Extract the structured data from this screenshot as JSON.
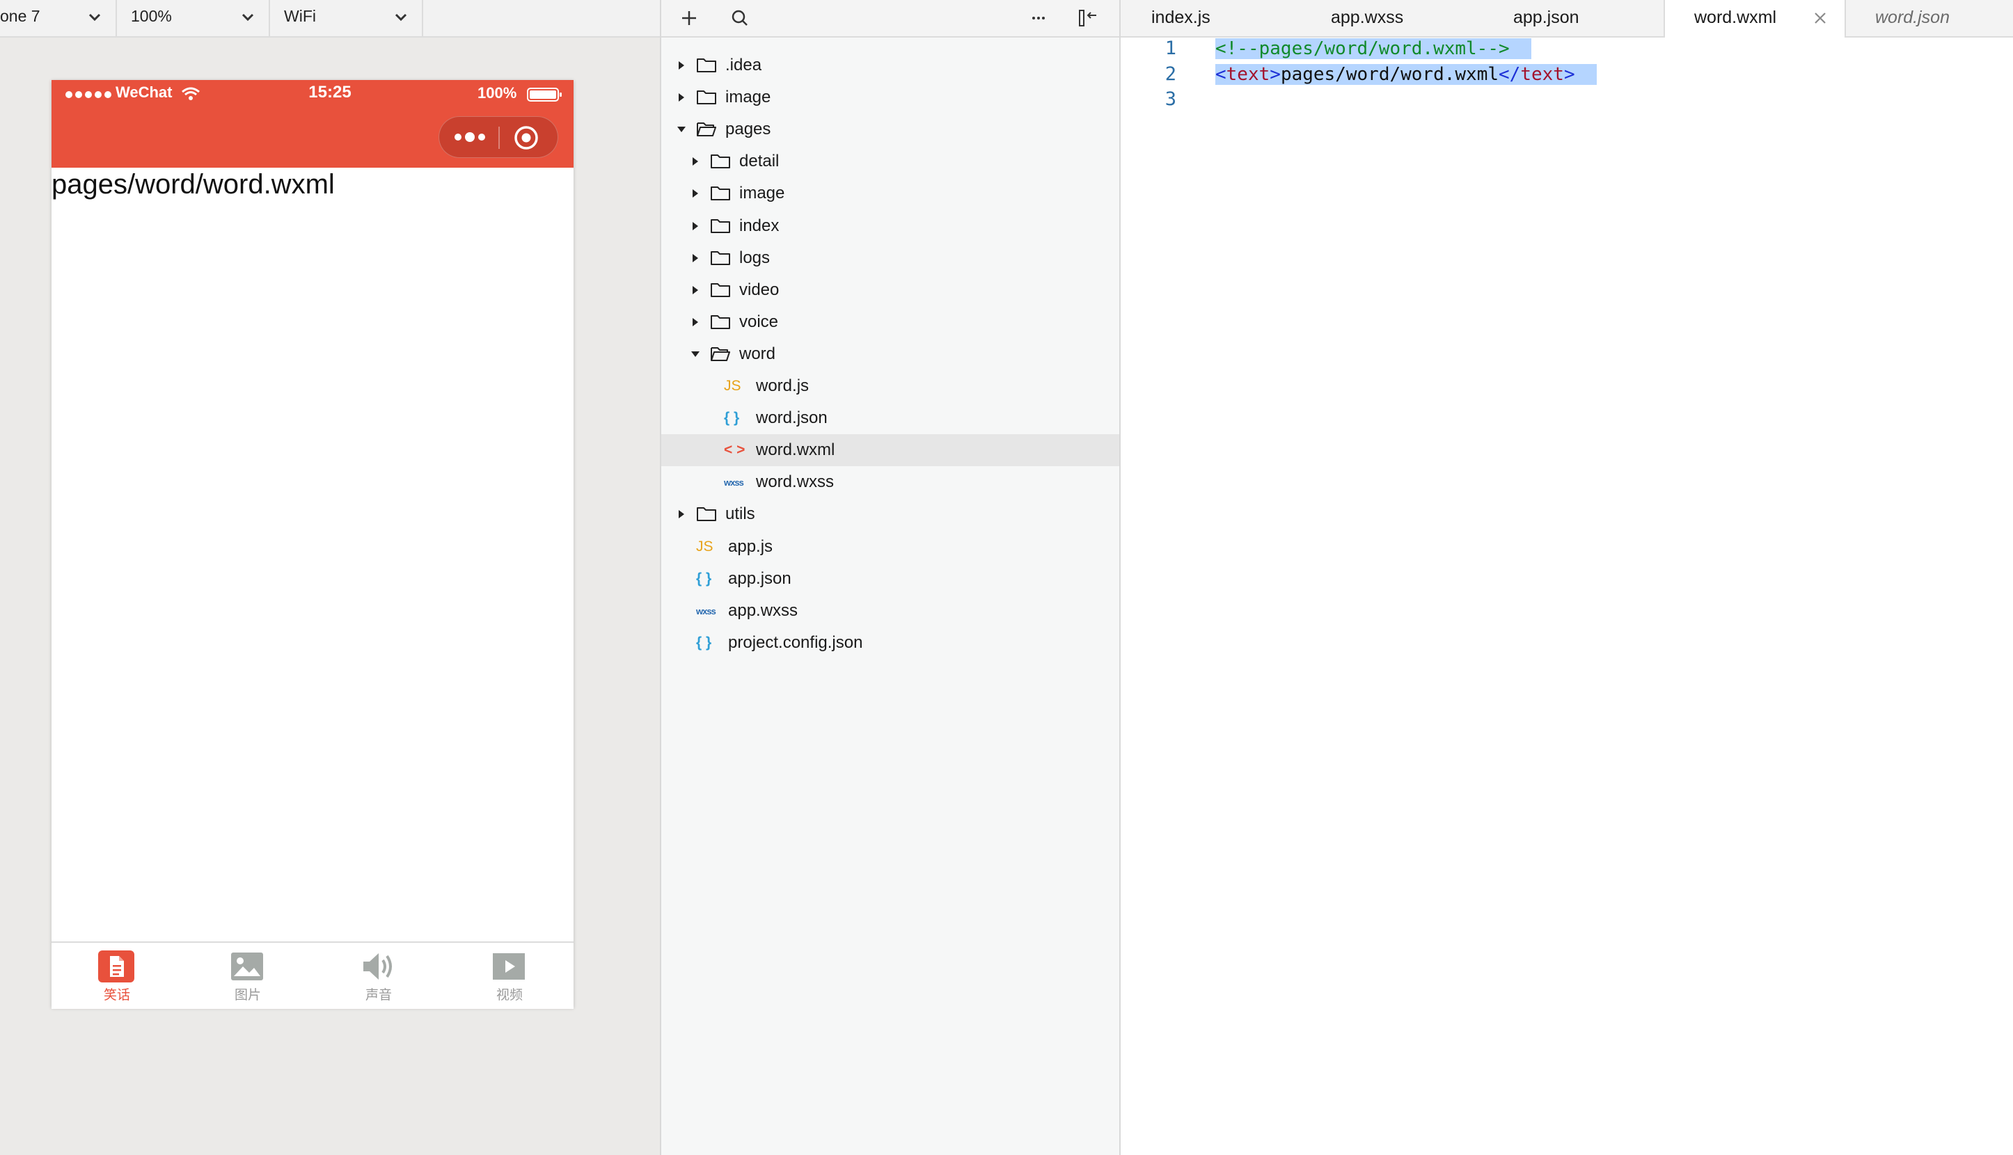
{
  "simulator": {
    "toolbar": {
      "device": "one 7",
      "zoom": "100%",
      "network": "WiFi"
    },
    "status_bar": {
      "carrier": "WeChat",
      "time": "15:25",
      "battery": "100%"
    },
    "page_text": "pages/word/word.wxml",
    "tabbar": [
      {
        "label": "笑话",
        "icon": "document-icon",
        "active": true
      },
      {
        "label": "图片",
        "icon": "image-icon",
        "active": false
      },
      {
        "label": "声音",
        "icon": "speaker-icon",
        "active": false
      },
      {
        "label": "视频",
        "icon": "video-icon",
        "active": false
      }
    ],
    "accent_color": "#e8513c"
  },
  "explorer": {
    "tree": [
      {
        "label": ".idea",
        "type": "folder",
        "depth": 0,
        "expanded": false
      },
      {
        "label": "image",
        "type": "folder",
        "depth": 0,
        "expanded": false
      },
      {
        "label": "pages",
        "type": "folder",
        "depth": 0,
        "expanded": true
      },
      {
        "label": "detail",
        "type": "folder",
        "depth": 1,
        "expanded": false
      },
      {
        "label": "image",
        "type": "folder",
        "depth": 1,
        "expanded": false
      },
      {
        "label": "index",
        "type": "folder",
        "depth": 1,
        "expanded": false
      },
      {
        "label": "logs",
        "type": "folder",
        "depth": 1,
        "expanded": false
      },
      {
        "label": "video",
        "type": "folder",
        "depth": 1,
        "expanded": false
      },
      {
        "label": "voice",
        "type": "folder",
        "depth": 1,
        "expanded": false
      },
      {
        "label": "word",
        "type": "folder",
        "depth": 1,
        "expanded": true
      },
      {
        "label": "word.js",
        "type": "js",
        "badge": "JS",
        "depth": 2
      },
      {
        "label": "word.json",
        "type": "json",
        "badge": "{ }",
        "depth": 2
      },
      {
        "label": "word.wxml",
        "type": "wxml",
        "badge": "< >",
        "depth": 2,
        "selected": true
      },
      {
        "label": "word.wxss",
        "type": "wxss",
        "badge": "wxss",
        "depth": 2
      },
      {
        "label": "utils",
        "type": "folder",
        "depth": 0,
        "expanded": false
      },
      {
        "label": "app.js",
        "type": "js",
        "badge": "JS",
        "depth": 0
      },
      {
        "label": "app.json",
        "type": "json",
        "badge": "{ }",
        "depth": 0
      },
      {
        "label": "app.wxss",
        "type": "wxss",
        "badge": "wxss",
        "depth": 0
      },
      {
        "label": "project.config.json",
        "type": "json",
        "badge": "{ }",
        "depth": 0
      }
    ]
  },
  "editor": {
    "tabs": [
      {
        "label": "index.js"
      },
      {
        "label": "app.wxss"
      },
      {
        "label": "app.json"
      },
      {
        "label": "word.wxml",
        "active": true
      },
      {
        "label": "word.json",
        "preview": true
      }
    ],
    "lines": [
      {
        "num": "1",
        "tokens": [
          [
            "c-comment",
            "<!--pages/word/word.wxml-->"
          ]
        ]
      },
      {
        "num": "2",
        "tokens": [
          [
            "c-punct",
            "<"
          ],
          [
            "c-tag",
            "text"
          ],
          [
            "c-punct",
            ">"
          ],
          [
            "c-text",
            "pages/word/word.wxml"
          ],
          [
            "c-punct",
            "</"
          ],
          [
            "c-tag",
            "text"
          ],
          [
            "c-punct",
            ">"
          ]
        ]
      },
      {
        "num": "3",
        "tokens": []
      }
    ]
  }
}
